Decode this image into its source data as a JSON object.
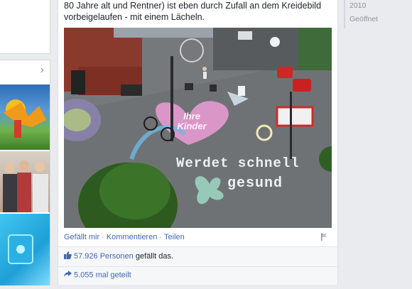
{
  "post": {
    "text_line1": "80 Jahre alt und Rentner) ist eben durch Zufall an dem Kreidebild",
    "text_line2": "vorbeigelaufen - mit einem Lächeln.",
    "actions": {
      "like": "Gefällt mir",
      "comment": "Kommentieren",
      "share": "Teilen"
    },
    "likes_count": "57.926 Personen",
    "likes_suffix": " gefällt das.",
    "shares": "5.055 mal geteilt"
  },
  "photo": {
    "chalk_heart": "Ihre Kinder",
    "chalk_line1": "Werdet schnell",
    "chalk_line2": "gesund"
  },
  "timeline": {
    "year": "2010",
    "status": "Geöffnet"
  },
  "icons": {
    "left_chevron": "chevron-right-icon",
    "like": "thumbs-up-icon",
    "share": "share-arrow-icon",
    "flag": "flag-icon"
  },
  "colors": {
    "link": "#4267b2",
    "background": "#e9ebee"
  }
}
